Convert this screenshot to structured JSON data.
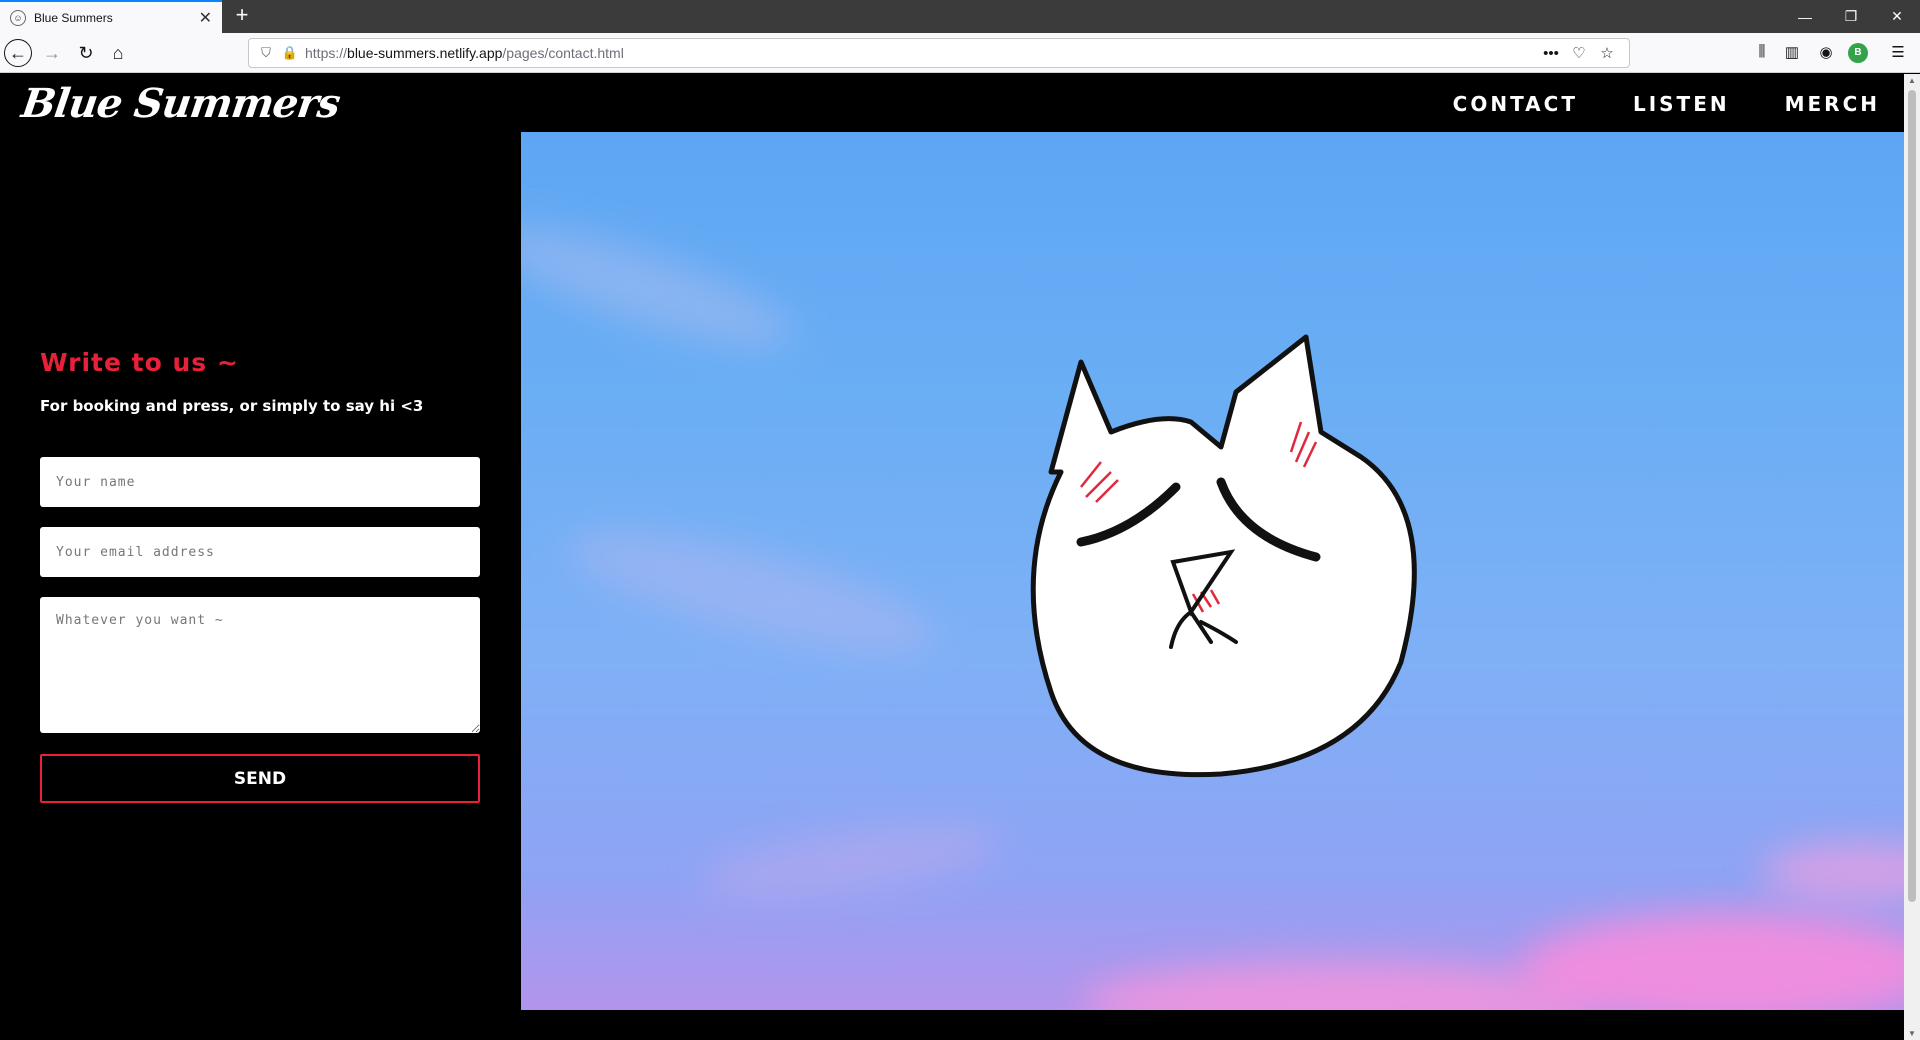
{
  "browser": {
    "tab_title": "Blue Summers",
    "url_prefix": "https://",
    "url_host": "blue-summers.netlify.app",
    "url_path": "/pages/contact.html",
    "extension_badge": "B"
  },
  "site": {
    "logo": "Blue Summers",
    "nav": [
      "CONTACT",
      "LISTEN",
      "MERCH"
    ]
  },
  "contact": {
    "heading": "Write to us ~",
    "subheading": "For booking and press, or simply to say hi <3",
    "name_placeholder": "Your name",
    "email_placeholder": "Your email address",
    "message_placeholder": "Whatever you want ~",
    "send_label": "SEND"
  },
  "colors": {
    "accent": "#e8203a",
    "background": "#000000",
    "sky_top": "#5ea6f3",
    "sky_bottom": "#b394ec"
  },
  "icons": [
    "back-arrow-icon",
    "forward-arrow-icon",
    "reload-icon",
    "home-icon",
    "shield-icon",
    "lock-icon",
    "page-actions-icon",
    "pocket-icon",
    "bookmark-star-icon",
    "library-icon",
    "sidebar-icon",
    "account-icon",
    "menu-icon"
  ]
}
